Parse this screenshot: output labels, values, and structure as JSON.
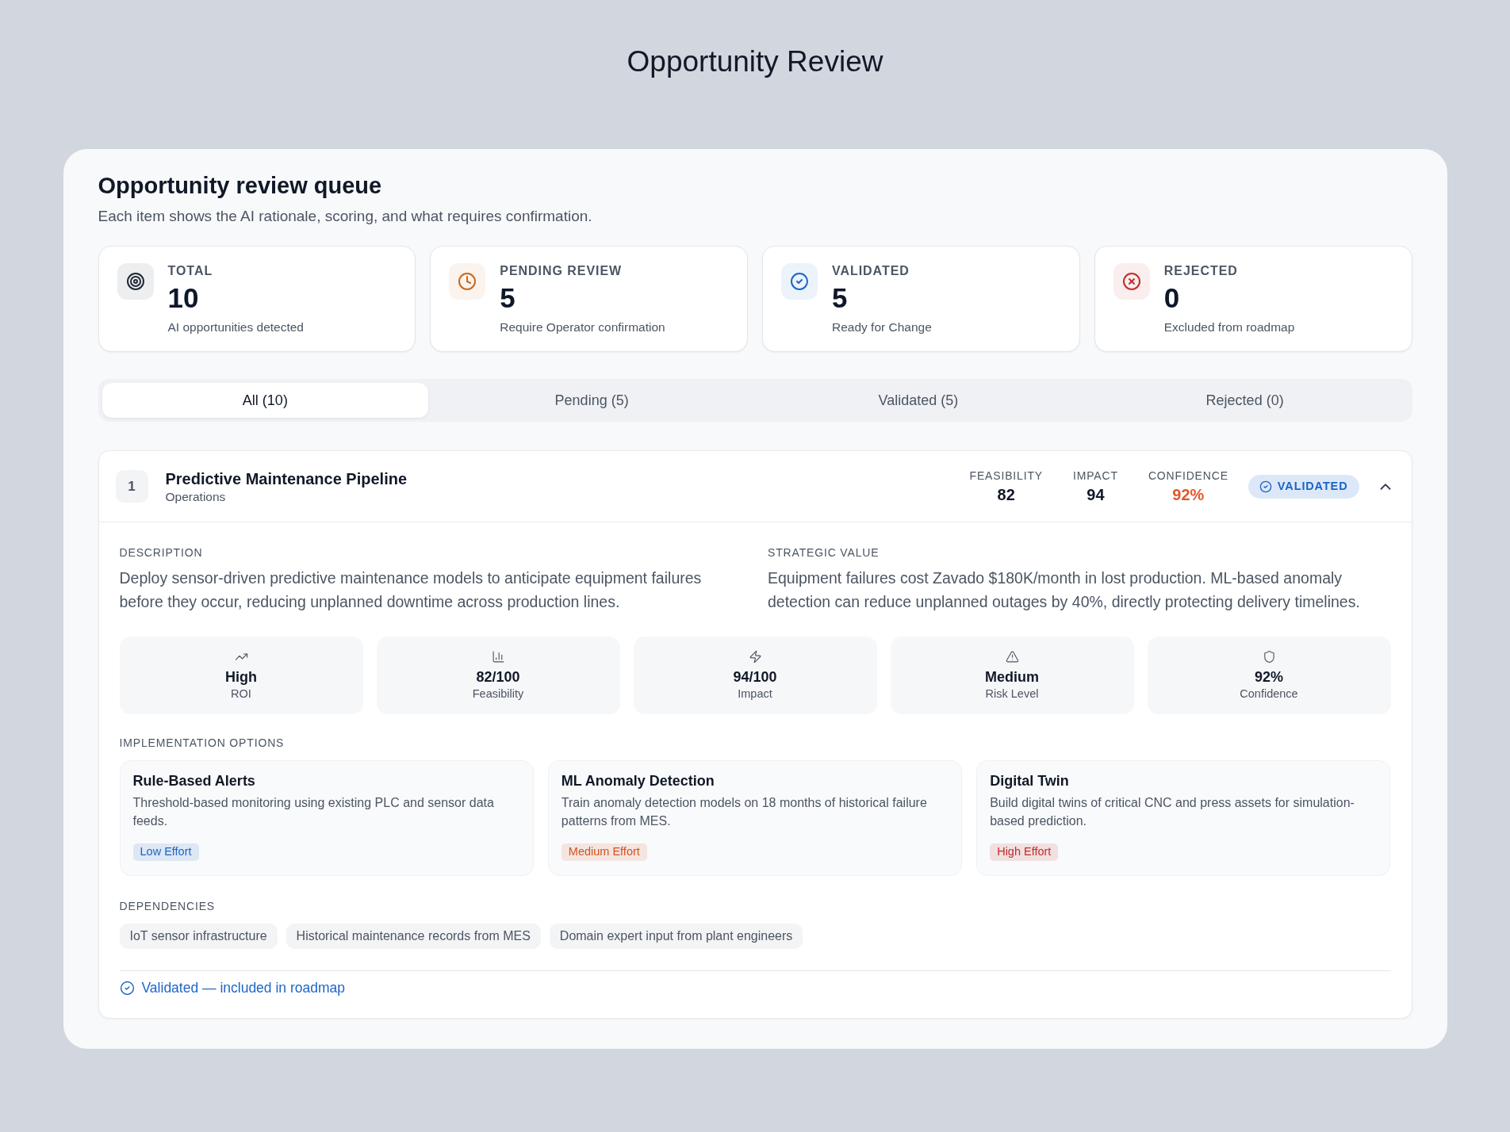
{
  "page": {
    "title": "Opportunity Review"
  },
  "queue": {
    "title": "Opportunity review queue",
    "subtitle": "Each item shows the AI rationale, scoring, and what requires confirmation."
  },
  "stats": [
    {
      "label": "TOTAL",
      "value": "10",
      "caption": "AI opportunities detected",
      "color": "#1f2937"
    },
    {
      "label": "PENDING REVIEW",
      "value": "5",
      "caption": "Require Operator confirmation",
      "color": "#c8691e"
    },
    {
      "label": "VALIDATED",
      "value": "5",
      "caption": "Ready for Change",
      "color": "#1d64c8"
    },
    {
      "label": "REJECTED",
      "value": "0",
      "caption": "Excluded from roadmap",
      "color": "#c42b2b"
    }
  ],
  "tabs": [
    {
      "label": "All (10)",
      "selected": true
    },
    {
      "label": "Pending (5)",
      "selected": false
    },
    {
      "label": "Validated (5)",
      "selected": false
    },
    {
      "label": "Rejected (0)",
      "selected": false
    }
  ],
  "opportunities": [
    {
      "number": "1",
      "title": "Predictive Maintenance Pipeline",
      "category": "Operations",
      "scores": [
        {
          "label": "FEASIBILITY",
          "value": "82",
          "color": "#111827"
        },
        {
          "label": "IMPACT",
          "value": "94",
          "color": "#111827"
        },
        {
          "label": "CONFIDENCE",
          "value": "92%",
          "color": "#e2582b"
        }
      ],
      "status": {
        "kind": "validated",
        "label": "VALIDATED",
        "note": "Validated — included in roadmap"
      },
      "expanded": true,
      "description": {
        "label": "DESCRIPTION",
        "text": "Deploy sensor-driven predictive maintenance models to anticipate equipment failures before they occur, reducing unplanned downtime across production lines."
      },
      "strategic_value": {
        "label": "STRATEGIC VALUE",
        "text": "Equipment failures cost Zavado $180K/month in lost production. ML-based anomaly detection can reduce unplanned outages by 40%, directly protecting delivery timelines."
      },
      "metrics": [
        {
          "value": "High",
          "label": "ROI"
        },
        {
          "value": "82/100",
          "label": "Feasibility"
        },
        {
          "value": "94/100",
          "label": "Impact"
        },
        {
          "value": "Medium",
          "label": "Risk Level"
        },
        {
          "value": "92%",
          "label": "Confidence"
        }
      ],
      "options_label": "IMPLEMENTATION OPTIONS",
      "options": [
        {
          "title": "Rule-Based Alerts",
          "description": "Threshold-based monitoring using existing PLC and sensor data feeds.",
          "effort": "Low Effort",
          "color": "#1d64c8"
        },
        {
          "title": "ML Anomaly Detection",
          "description": "Train anomaly detection models on 18 months of historical failure patterns from MES.",
          "effort": "Medium Effort",
          "color": "#d4531f"
        },
        {
          "title": "Digital Twin",
          "description": "Build digital twins of critical CNC and press assets for simulation-based prediction.",
          "effort": "High Effort",
          "color": "#c42b2b"
        }
      ],
      "dependencies_label": "DEPENDENCIES",
      "dependencies": [
        "IoT sensor infrastructure",
        "Historical maintenance records from MES",
        "Domain expert input from plant engineers"
      ]
    }
  ]
}
